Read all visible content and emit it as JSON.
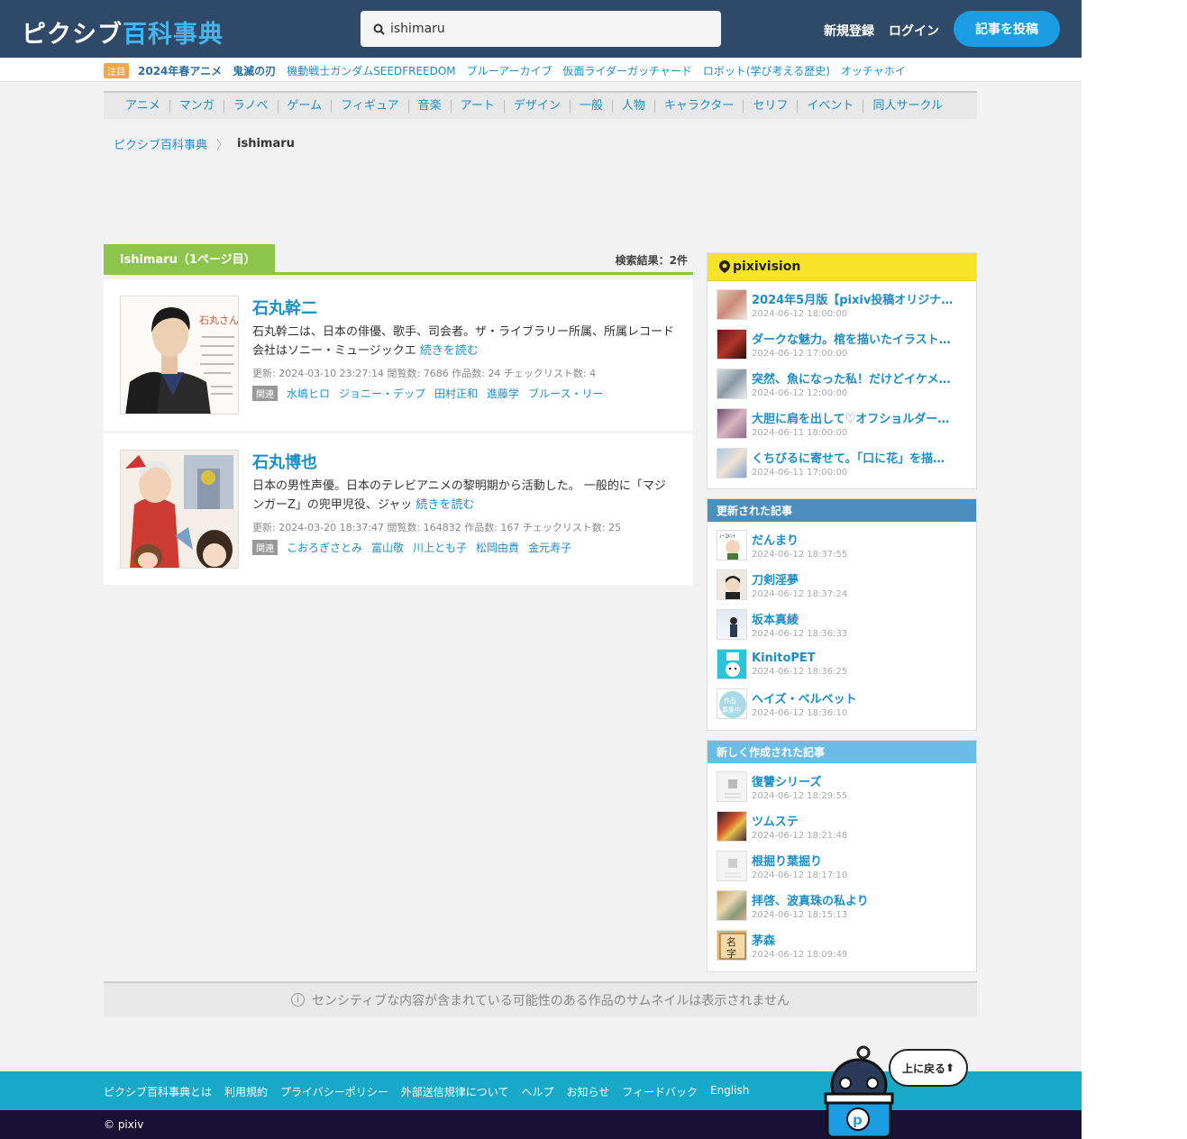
{
  "header": {
    "logo_kana": "ピクシブ",
    "logo_kanji": "百科事典",
    "search_value": "ishimaru",
    "signup": "新規登録",
    "login": "ログイン",
    "post": "記事を投稿"
  },
  "trending": {
    "badge": "注目",
    "items": [
      "2024年春アニメ",
      "鬼滅の刃",
      "機動戦士ガンダムSEEDFREEDOM",
      "ブルーアーカイブ",
      "仮面ライダーガッチャード",
      "ロボット(学び考える歴史)",
      "オッチャホイ"
    ]
  },
  "categories": [
    "アニメ",
    "マンガ",
    "ラノベ",
    "ゲーム",
    "フィギュア",
    "音楽",
    "アート",
    "デザイン",
    "一般",
    "人物",
    "キャラクター",
    "セリフ",
    "イベント",
    "同人サークル"
  ],
  "breadcrumb": {
    "home": "ピクシブ百科事典",
    "current": "ishimaru"
  },
  "results": {
    "tab": "ishimaru（1ページ目）",
    "count": "検索結果：2件",
    "items": [
      {
        "title": "石丸幹二",
        "desc": "石丸幹二は、日本の俳優、歌手、司会者。ザ・ライブラリー所属、所属レコード会社はソニー・ミュージックエ",
        "more": "続きを読む",
        "meta": "更新: 2024-03-10 23:27:14  閲覧数: 7686  作品数: 24  チェックリスト数: 4",
        "rel_label": "関連",
        "related": [
          "水嶋ヒロ",
          "ジョニー・デップ",
          "田村正和",
          "進藤学",
          "ブルース・リー"
        ]
      },
      {
        "title": "石丸博也",
        "desc": "日本の男性声優。日本のテレビアニメの黎明期から活動した。 一般的に「マジンガーZ」の兜甲児役、ジャッ",
        "more": "続きを読む",
        "meta": "更新: 2024-03-20 18:37:47  閲覧数: 164832  作品数: 167  チェックリスト数: 25",
        "rel_label": "関連",
        "related": [
          "こおろぎさとみ",
          "富山敬",
          "川上とも子",
          "松岡由貴",
          "金元寿子"
        ]
      }
    ]
  },
  "pixivision": {
    "title": "pixivision",
    "items": [
      {
        "title": "2024年5月版【pixiv投稿オリジナ…",
        "date": "2024-06-12 18:00:00"
      },
      {
        "title": "ダークな魅力。棺を描いたイラスト…",
        "date": "2024-06-12 17:00:00"
      },
      {
        "title": "突然、魚になった私！だけどイケメ…",
        "date": "2024-06-12 12:00:00"
      },
      {
        "title": "大胆に肩を出して♡オフショルダー…",
        "date": "2024-06-11 18:00:00"
      },
      {
        "title": "くちびるに寄せて。「口に花」を描…",
        "date": "2024-06-11 17:00:00"
      }
    ]
  },
  "updated": {
    "title": "更新された記事",
    "items": [
      {
        "title": "だんまり",
        "date": "2024-06-12 18:37:55"
      },
      {
        "title": "刀剣淫夢",
        "date": "2024-06-12 18:37:24"
      },
      {
        "title": "坂本真綾",
        "date": "2024-06-12 18:36:33"
      },
      {
        "title": "KinitoPET",
        "date": "2024-06-12 18:36:25"
      },
      {
        "title": "ヘイズ・ベルベット",
        "date": "2024-06-12 18:36:10"
      }
    ]
  },
  "created": {
    "title": "新しく作成された記事",
    "items": [
      {
        "title": "復讐シリーズ",
        "date": "2024-06-12 18:29:55"
      },
      {
        "title": "ツムステ",
        "date": "2024-06-12 18:21:48"
      },
      {
        "title": "根掘り葉掘り",
        "date": "2024-06-12 18:17:10"
      },
      {
        "title": "拝啓、波真珠の私より",
        "date": "2024-06-12 18:15:13"
      },
      {
        "title": "茅森",
        "date": "2024-06-12 18:09:49"
      }
    ]
  },
  "notice": "センシティブな内容が含まれている可能性のある作品のサムネイルは表示されません",
  "footer": {
    "links": [
      "ピクシブ百科事典とは",
      "利用規約",
      "プライバシーポリシー",
      "外部送信規律について",
      "ヘルプ",
      "お知らせ",
      "フィードバック",
      "English"
    ],
    "copyright": "© pixiv",
    "back_to_top": "上に戻る"
  },
  "colors": {
    "header_bg": "#2e4a68",
    "accent_blue": "#1a9de2",
    "result_green": "#8dc44b",
    "pixivision_yellow": "#f7e426",
    "updated_head": "#4a8fc0",
    "created_head": "#6bbde8",
    "footer_bg": "#18a8c8"
  }
}
